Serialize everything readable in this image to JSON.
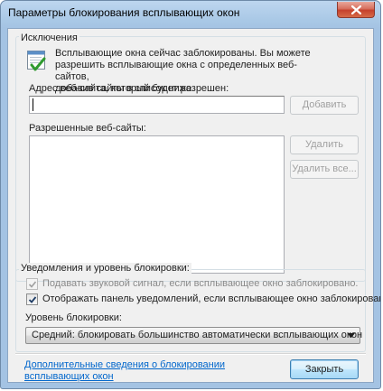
{
  "window": {
    "title": "Параметры блокирования всплывающих окон"
  },
  "exceptions": {
    "group_label": "Исключения",
    "info_text": "Всплывающие окна сейчас заблокированы. Вы можете\nразрешить всплывающие окна с определенных веб-сайтов,\nдобавив сайты в список ниже.",
    "address_label": "Адрес веб-сайта, который будет разрешен:",
    "address_value": "",
    "add_button": "Добавить",
    "allowed_label": "Разрешенные веб-сайты:",
    "allowed_sites": [],
    "remove_button": "Удалить",
    "remove_all_button": "Удалить все..."
  },
  "notifications": {
    "group_label": "Уведомления и уровень блокировки:",
    "sound_checkbox": {
      "label": "Подавать звуковой сигнал, если всплывающее окно заблокировано.",
      "checked": true,
      "enabled": false
    },
    "bar_checkbox": {
      "label": "Отображать панель уведомлений, если всплывающее окно заблокировано.",
      "checked": true,
      "enabled": true
    },
    "level_label": "Уровень блокировки:",
    "level_value": "Средний: блокировать большинство автоматически всплывающих окон"
  },
  "footer": {
    "help_link": "Дополнительные сведения о блокировании\nвсплывающих окон",
    "close_button": "Закрыть"
  },
  "icons": {
    "info": "popup-window-check-icon",
    "close": "close-icon",
    "dropdown": "chevron-down-icon",
    "check": "checkmark-icon"
  }
}
